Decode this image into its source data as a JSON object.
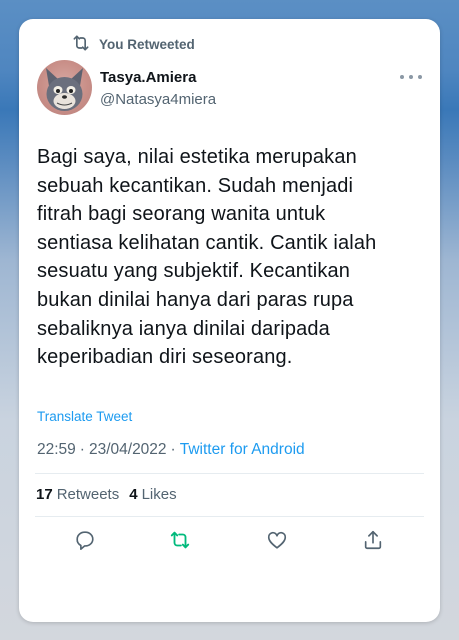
{
  "retweet_context": {
    "label": "You Retweeted",
    "icon": "retweet-icon"
  },
  "author": {
    "display_name": "Tasya.Amiera",
    "handle": "@Natasya4miera"
  },
  "tweet": {
    "text": "Bagi saya, nilai estetika merupakan\nsebuah kecantikan. Sudah menjadi\nfitrah bagi seorang wanita untuk\nsentiasa kelihatan cantik. Cantik ialah\nsesuatu yang subjektif.  Kecantikan\nbukan dinilai hanya dari paras rupa\nsebaliknya ianya dinilai daripada\nkeperibadian diri seseorang.",
    "translate_label": "Translate Tweet",
    "time": "22:59",
    "date": "23/04/2022",
    "separator": "·",
    "source": "Twitter for Android"
  },
  "stats": {
    "retweets_count": "17",
    "retweets_label": "Retweets",
    "likes_count": "4",
    "likes_label": "Likes"
  },
  "actions": [
    "reply-icon",
    "retweet-icon",
    "like-icon",
    "share-icon"
  ],
  "colors": {
    "link": "#1d9bf0",
    "retweet_active": "#00ba7c",
    "secondary_text": "#536471",
    "primary_text": "#0f1419"
  }
}
